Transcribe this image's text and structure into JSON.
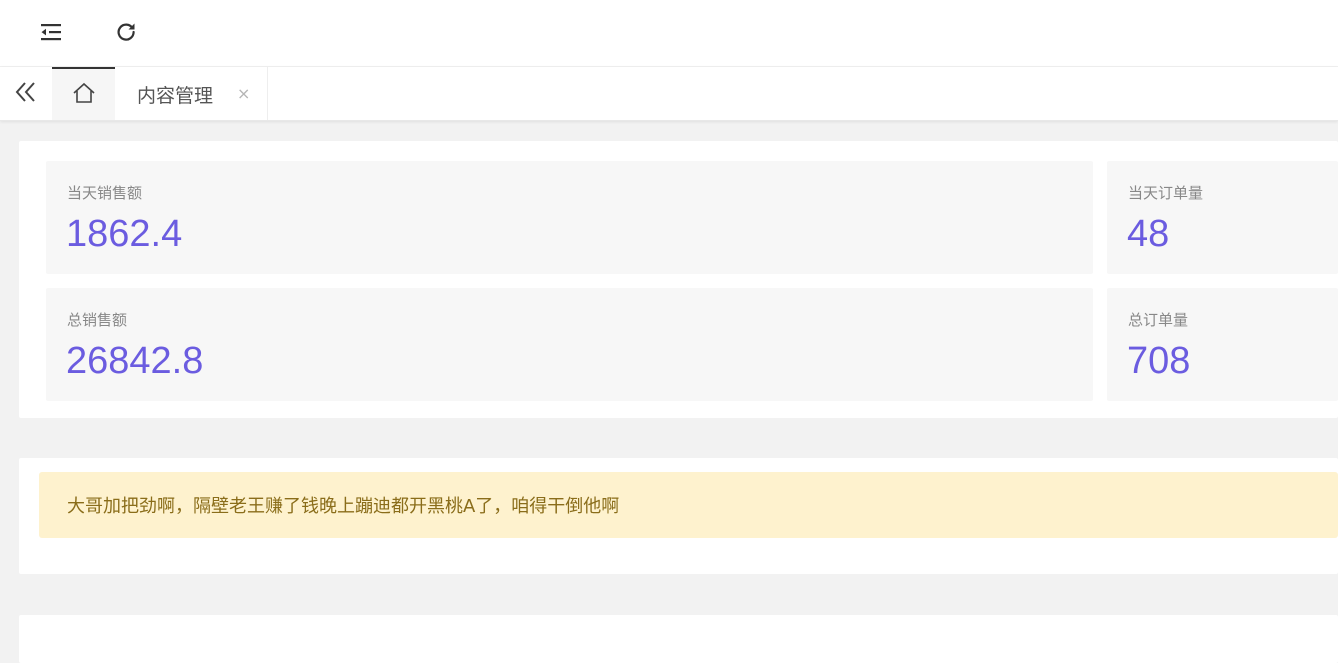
{
  "header": {
    "menu_icon": "indent-menu-icon",
    "refresh_icon": "refresh-icon"
  },
  "tabs": {
    "prev_icon": "double-chevron-left-icon",
    "home_icon": "home-icon",
    "items": [
      {
        "label": "内容管理",
        "close": "×"
      }
    ]
  },
  "stats": [
    {
      "title": "当天销售额",
      "value": "1862.4"
    },
    {
      "title": "当天订单量",
      "value": "48"
    },
    {
      "title": "总销售额",
      "value": "26842.8"
    },
    {
      "title": "总订单量",
      "value": "708"
    }
  ],
  "notice": {
    "text": "大哥加把劲啊，隔壁老王赚了钱晚上蹦迪都开黑桃A了，咱得干倒他啊"
  },
  "colors": {
    "accent": "#6b5ce0",
    "notice_bg": "#fef2ce",
    "notice_text": "#8a6d1a",
    "page_bg": "#f2f2f2"
  }
}
